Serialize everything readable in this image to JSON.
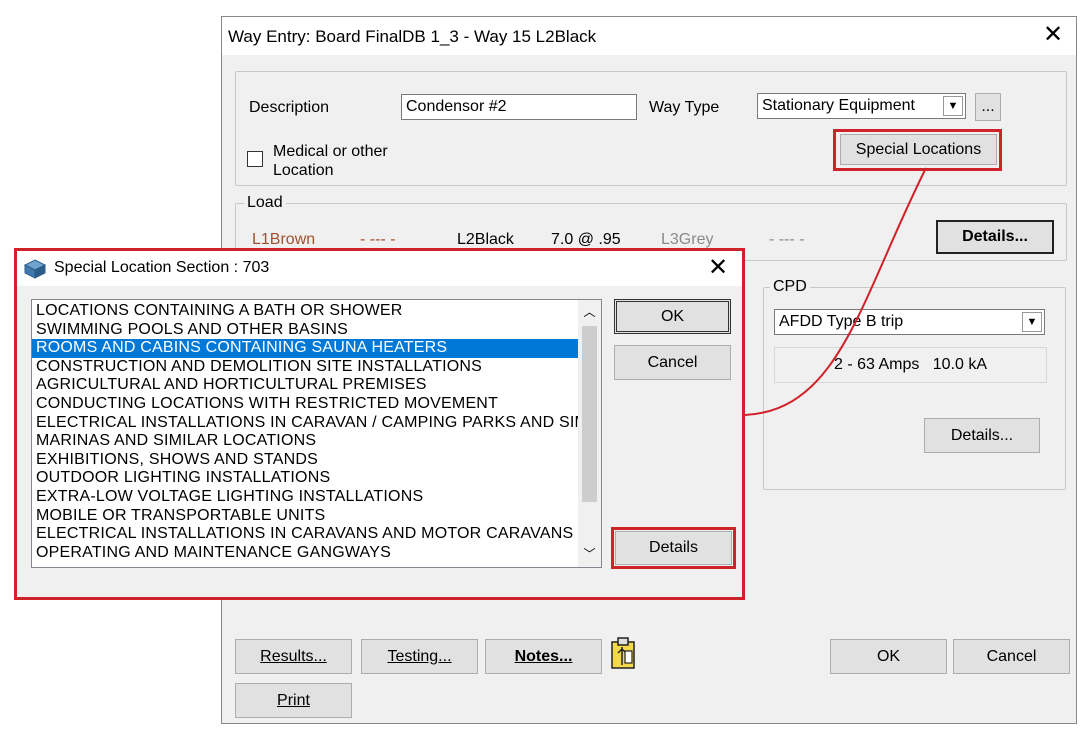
{
  "way_entry": {
    "title": "Way Entry: Board FinalDB 1_3 - Way 15 L2Black",
    "description_label": "Description",
    "description_value": "Condensor #2",
    "way_type_label": "Way Type",
    "way_type_value": "Stationary Equipment",
    "browse_label": "...",
    "medical_label_line1": "Medical or other",
    "medical_label_line2": "Location",
    "special_locations_label": "Special Locations",
    "load": {
      "group_label": "Load",
      "l1": "L1Brown",
      "l1_value": "- --- -",
      "l2": "L2Black",
      "l2_value": "7.0 @ .95",
      "l3": "L3Grey",
      "l3_value": "- --- -",
      "details_label": "Details..."
    },
    "cpd": {
      "group_label": "CPD",
      "type_value": "AFDD Type B trip",
      "rating": "2 - 63 Amps   10.0 kA",
      "details_label": "Details..."
    },
    "buttons": {
      "results": "Results...",
      "testing": "Testing...",
      "notes": "Notes...",
      "ok": "OK",
      "cancel": "Cancel",
      "print": "Print"
    }
  },
  "special_location_dialog": {
    "title": "Special Location Section : 703",
    "items": [
      "LOCATIONS CONTAINING A BATH OR SHOWER",
      "SWIMMING POOLS AND OTHER BASINS",
      "ROOMS AND CABINS CONTAINING SAUNA HEATERS",
      "CONSTRUCTION AND DEMOLITION SITE INSTALLATIONS",
      "AGRICULTURAL AND HORTICULTURAL PREMISES",
      "CONDUCTING LOCATIONS WITH RESTRICTED MOVEMENT",
      "ELECTRICAL INSTALLATIONS IN CARAVAN / CAMPING PARKS AND SIMI",
      "MARINAS AND SIMILAR LOCATIONS",
      "EXHIBITIONS, SHOWS AND STANDS",
      "OUTDOOR LIGHTING INSTALLATIONS",
      "EXTRA-LOW VOLTAGE LIGHTING INSTALLATIONS",
      "MOBILE OR TRANSPORTABLE UNITS",
      "ELECTRICAL INSTALLATIONS IN CARAVANS AND MOTOR CARAVANS",
      "OPERATING AND MAINTENANCE GANGWAYS"
    ],
    "selected_item": "ROOMS AND CABINS CONTAINING SAUNA HEATERS",
    "ok_label": "OK",
    "cancel_label": "Cancel",
    "details_label": "Details"
  },
  "colors": {
    "highlight_red": "#d0222a",
    "selection_blue": "#0078d7",
    "l1_brown": "#a0522d",
    "l3_grey": "#8a8a8a"
  }
}
